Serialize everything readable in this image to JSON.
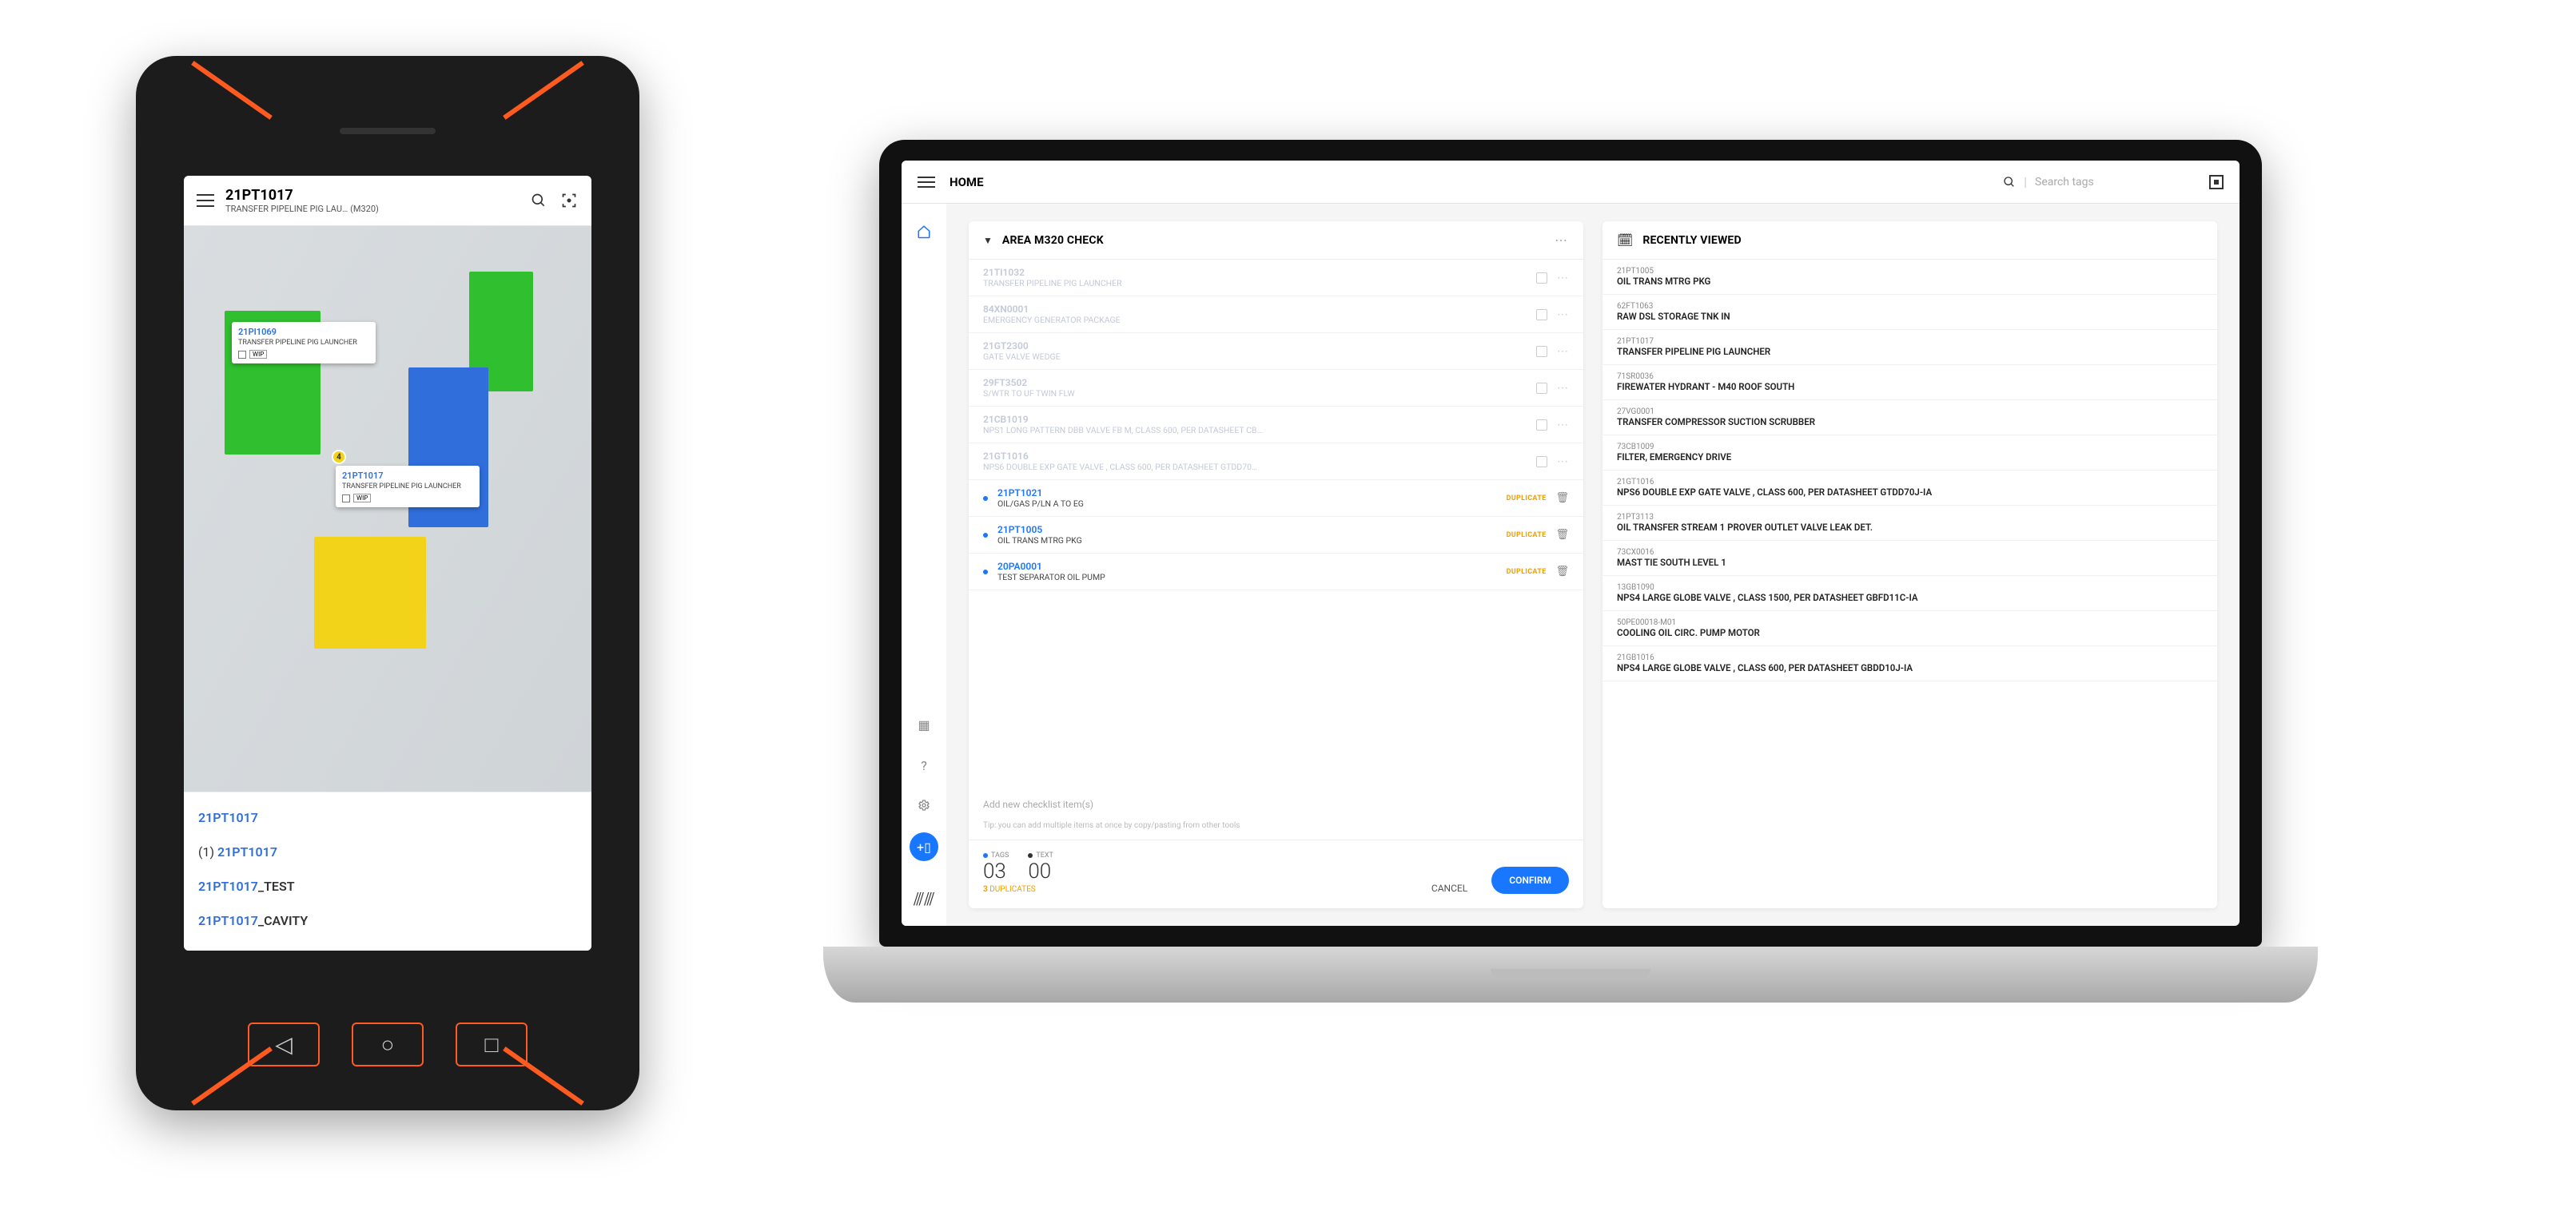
{
  "phone": {
    "header": {
      "title": "21PT1017",
      "subtitle": "TRANSFER PIPELINE PIG LAU…   (M320)"
    },
    "pins": [
      {
        "id": "21PI1069",
        "desc": "TRANSFER PIPELINE PIG LAUNCHER",
        "badge": "WIP"
      },
      {
        "id": "21PT1017",
        "desc": "TRANSFER PIPELINE PIG LAUNCHER",
        "badge": "WIP"
      }
    ],
    "marker_count": "4",
    "suggestions": [
      {
        "prefix": "",
        "id": "21PT1017",
        "suffix": ""
      },
      {
        "prefix": "(1) ",
        "id": "21PT1017",
        "suffix": ""
      },
      {
        "prefix": "",
        "id": "21PT1017",
        "suffix": "_TEST"
      },
      {
        "prefix": "",
        "id": "21PT1017",
        "suffix": "_CAVITY"
      }
    ]
  },
  "laptop": {
    "header": {
      "home": "HOME",
      "search_placeholder": "Search tags"
    },
    "checklist": {
      "title": "AREA M320 CHECK",
      "faded_rows": [
        {
          "id": "21TI1032",
          "desc": "TRANSFER PIPELINE PIG LAUNCHER"
        },
        {
          "id": "84XN0001",
          "desc": "EMERGENCY GENERATOR PACKAGE"
        },
        {
          "id": "21GT2300",
          "desc": "GATE VALVE WEDGE"
        },
        {
          "id": "29FT3502",
          "desc": "S/WTR TO UF TWIN FLW"
        },
        {
          "id": "21CB1019",
          "desc": "NPS1 LONG PATTERN DBB VALVE FB M, CLASS 600, PER DATASHEET CB…"
        },
        {
          "id": "21GT1016",
          "desc": "NPS6 DOUBLE EXP GATE VALVE , CLASS 600, PER DATASHEET GTDD70…"
        }
      ],
      "active_rows": [
        {
          "id": "21PT1021",
          "desc": "OIL/GAS P/LN A TO EG",
          "dup": "DUPLICATE"
        },
        {
          "id": "21PT1005",
          "desc": "OIL TRANS MTRG PKG",
          "dup": "DUPLICATE"
        },
        {
          "id": "20PA0001",
          "desc": "TEST SEPARATOR OIL PUMP",
          "dup": "DUPLICATE"
        }
      ],
      "add_placeholder": "Add new checklist item(s)",
      "tip": "Tip: you can add multiple items at once by copy/pasting from other tools",
      "footer": {
        "tags_label": "TAGS",
        "tags_count": "03",
        "text_label": "TEXT",
        "text_count": "00",
        "dup_count": "3",
        "dup_label": "DUPLICATES",
        "cancel": "CANCEL",
        "confirm": "CONFIRM"
      }
    },
    "recent": {
      "title": "RECENTLY VIEWED",
      "rows": [
        {
          "id": "21PT1005",
          "desc": "OIL TRANS MTRG PKG"
        },
        {
          "id": "62FT1063",
          "desc": "RAW DSL STORAGE TNK IN"
        },
        {
          "id": "21PT1017",
          "desc": "TRANSFER PIPELINE PIG LAUNCHER"
        },
        {
          "id": "71SR0036",
          "desc": "FIREWATER HYDRANT - M40 ROOF SOUTH"
        },
        {
          "id": "27VG0001",
          "desc": "TRANSFER COMPRESSOR SUCTION SCRUBBER"
        },
        {
          "id": "73CB1009",
          "desc": "FILTER, EMERGENCY DRIVE"
        },
        {
          "id": "21GT1016",
          "desc": "NPS6 DOUBLE EXP GATE VALVE , CLASS 600, PER DATASHEET GTDD70J-IA"
        },
        {
          "id": "21PT3113",
          "desc": "OIL TRANSFER STREAM 1 PROVER OUTLET VALVE LEAK DET."
        },
        {
          "id": "73CX0016",
          "desc": "MAST TIE SOUTH LEVEL 1"
        },
        {
          "id": "13GB1090",
          "desc": "NPS4 LARGE GLOBE VALVE , CLASS 1500, PER DATASHEET GBFD11C-IA"
        },
        {
          "id": "50PE00018-M01",
          "desc": "COOLING OIL CIRC. PUMP MOTOR"
        },
        {
          "id": "21GB1016",
          "desc": "NPS4 LARGE GLOBE VALVE , CLASS 600, PER DATASHEET GBDD10J-IA"
        }
      ]
    }
  }
}
